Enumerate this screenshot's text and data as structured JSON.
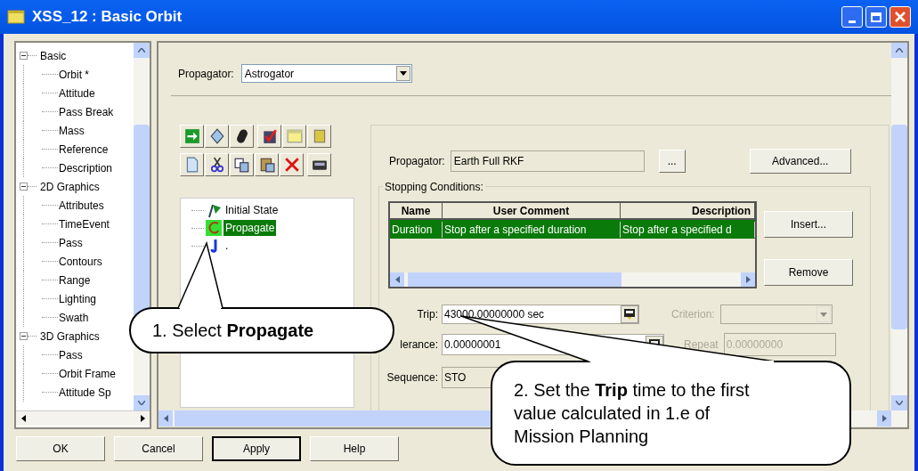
{
  "window": {
    "title": "XSS_12 : Basic Orbit"
  },
  "sidebar": {
    "items": [
      {
        "label": "Basic",
        "expanded": true,
        "children": [
          {
            "label": "Orbit *"
          },
          {
            "label": "Attitude"
          },
          {
            "label": "Pass Break"
          },
          {
            "label": "Mass"
          },
          {
            "label": "Reference"
          },
          {
            "label": "Description"
          }
        ]
      },
      {
        "label": "2D Graphics",
        "expanded": true,
        "children": [
          {
            "label": "Attributes"
          },
          {
            "label": "TimeEvent"
          },
          {
            "label": "Pass"
          },
          {
            "label": "Contours"
          },
          {
            "label": "Range"
          },
          {
            "label": "Lighting"
          },
          {
            "label": "Swath"
          }
        ]
      },
      {
        "label": "3D Graphics",
        "expanded": true,
        "children": [
          {
            "label": "Pass"
          },
          {
            "label": "Orbit Frame"
          },
          {
            "label": "Attitude Sp"
          }
        ]
      }
    ]
  },
  "propagator": {
    "label": "Propagator:",
    "value": "Astrogator"
  },
  "mission_sequence": [
    {
      "kind": "initial",
      "label": "Initial State",
      "selected": false
    },
    {
      "kind": "propagate",
      "label": "Propagate",
      "selected": true
    },
    {
      "kind": "end",
      "label": ".",
      "selected": false
    }
  ],
  "segment": {
    "propagator_label": "Propagator:",
    "propagator_value": "Earth Full RKF",
    "browse_button": "...",
    "advanced_button": "Advanced...",
    "stopping_conditions": {
      "title": "Stopping Conditions:",
      "columns": [
        "Name",
        "User Comment",
        "Description"
      ],
      "rows": [
        {
          "cells": [
            "Duration",
            "Stop after a specified duration",
            "Stop after a specified d"
          ],
          "selected": true
        }
      ],
      "buttons": [
        "Insert...",
        "Remove"
      ]
    },
    "trip": {
      "label": "Trip:",
      "value": "43000.00000000 sec"
    },
    "criterion": {
      "label": "Criterion:",
      "disabled": true
    },
    "tolerance": {
      "label": "lerance:",
      "value": "0.00000001"
    },
    "repeat": {
      "label": "Repeat",
      "value": "0.00000000",
      "disabled": true
    },
    "sequence": {
      "label": "Sequence:",
      "value": "STO"
    }
  },
  "buttons": [
    {
      "label": "OK",
      "default": false
    },
    {
      "label": "Cancel",
      "default": false
    },
    {
      "label": "Apply",
      "default": true
    },
    {
      "label": "Help",
      "default": false
    }
  ],
  "callouts": [
    "1. Select **Propagate**",
    "2. Set the **Trip** time to the first value calculated in 1.e of Mission Planning"
  ]
}
